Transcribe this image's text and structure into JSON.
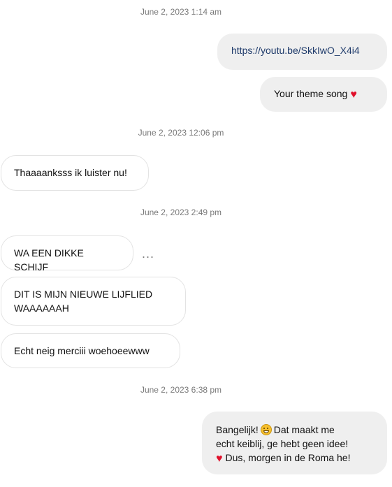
{
  "thread": {
    "timestamps": [
      "June 2, 2023 1:14 am",
      "June 2, 2023 12:06 pm",
      "June 2, 2023 2:49 pm",
      "June 2, 2023 6:38 pm"
    ],
    "messages": {
      "link": "https://youtu.be/SkkIwO_X4i4",
      "theme_song": "Your theme song",
      "thanks": "Thaaaanksss ik luister nu!",
      "schijf": "WA EEN DIKKE SCHIJF",
      "lijflied_line1": "DIT IS MIJN NIEUWE LIJFLIED",
      "lijflied_line2": "WAAAAAAH",
      "merci": "Echt neig merciii woehoeewww",
      "last_part1": "Bangelijk!",
      "last_part2": "Dat maakt me",
      "last_line2": "echt keiblij, ge hebt geen idee!",
      "last_line3": "Dus, morgen in de Roma he!"
    },
    "more_options": "..."
  },
  "icons": {
    "heart": "red-heart-icon",
    "grin": "grinning-face-icon",
    "more": "more-options-icon"
  },
  "colors": {
    "outgoing_bubble": "#efefef",
    "incoming_border": "#e3e3e3",
    "timestamp": "#7a7a7a",
    "heart": "#e0102b"
  }
}
